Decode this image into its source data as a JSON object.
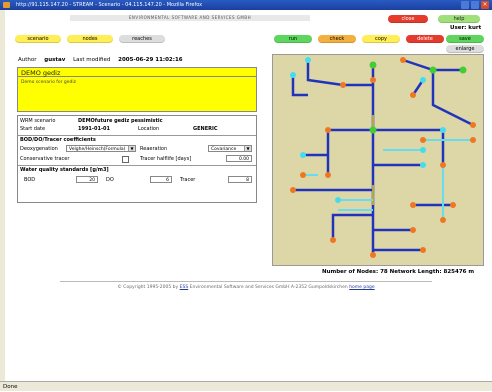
{
  "window": {
    "title": "http://91.115.147.20 - STREAM - Scenario - 04.115.147.20 - Mozilla Firefox"
  },
  "banner": "ENVIRONMENTAL SOFTWARE AND SERVICES GMBH",
  "top_buttons": {
    "close": "close",
    "help": "help"
  },
  "user": "User: kurt",
  "tabs": {
    "scenario": "scenario",
    "nodes": "nodes",
    "reaches": "reaches"
  },
  "actions": {
    "run": "run",
    "check": "check",
    "copy": "copy",
    "delete": "delete",
    "save": "save",
    "enlarge": "enlarge"
  },
  "meta": {
    "author_label": "Author",
    "author_value": "gustav",
    "modified_label": "Last modified",
    "modified_value": "2005-06-29 11:02:16"
  },
  "scenario_title": "DEMO gediz",
  "scenario_description": "Demo scenario for gediz",
  "params": {
    "wrm_label": "WRM scenario",
    "wrm_value": "DEMOfuture gediz pessimistic",
    "start_label": "Start date",
    "start_value": "1991-01-01",
    "location_label": "Location",
    "location_value": "GENERIC"
  },
  "coeffs": {
    "header": "BOD/DO/Tracer coefficients",
    "deoxy_label": "Deoxygenation",
    "deoxy_value": "Velghe/Heinsch(Formula)",
    "reaeration_label": "Reaeration",
    "reaeration_value": "Covariance",
    "conservative_label": "Conservative tracer",
    "halflife_label": "Tracer halflife [days]",
    "halflife_value": "0.00"
  },
  "standards": {
    "header": "Water quality standards [g/m3]",
    "bod_label": "BOD",
    "bod_value": "20",
    "do_label": "DO",
    "do_value": "6",
    "tracer_label": "Tracer",
    "tracer_value": "8"
  },
  "network": {
    "nodes_label": "Number of Nodes:",
    "nodes_value": "78",
    "length_label": "Network Length:",
    "length_value": "825476 m"
  },
  "footer": {
    "copyright": "© Copyright 1995-2005 by",
    "company": "ESS",
    "rest": "Environmental Software and Services GmbH A-2352 Gumpoldskirchen",
    "link": "home page"
  },
  "status": "Done",
  "colors": {
    "yellow": "#ffff00",
    "map_bg": "#ddd7a8",
    "pipe_dark": "#2233bb",
    "pipe_light": "#66ddee",
    "node_orange": "#ee7722",
    "node_cyan": "#44ddee",
    "node_green": "#44cc33"
  }
}
